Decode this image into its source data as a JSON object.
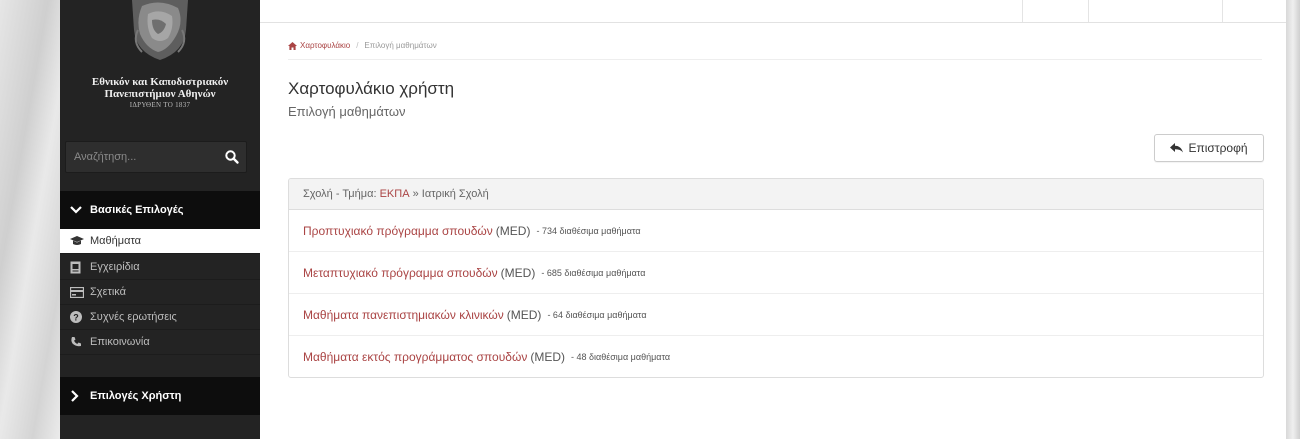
{
  "university": {
    "name_line1": "Εθνικόν και Καποδιστριακόν",
    "name_line2": "Πανεπιστήμιον Αθηνών",
    "founded": "ΙΔΡΥΘΕΝ ΤΟ 1837",
    "logo_icon": "athena-head-logo"
  },
  "search": {
    "placeholder": "Αναζήτηση...",
    "icon": "search-icon"
  },
  "sidebar": {
    "basic_header": "Βασικές Επιλογές",
    "user_header": "Επιλογές Χρήστη",
    "items": [
      {
        "label": "Μαθήματα",
        "icon": "graduation-cap-icon",
        "active": true
      },
      {
        "label": "Εγχειρίδια",
        "icon": "document-icon",
        "active": false
      },
      {
        "label": "Σχετικά",
        "icon": "card-icon",
        "active": false
      },
      {
        "label": "Συχνές ερωτήσεις",
        "icon": "question-circle-icon",
        "active": false
      },
      {
        "label": "Επικοινωνία",
        "icon": "phone-icon",
        "active": false
      }
    ]
  },
  "breadcrumb": {
    "home": "Χαρτοφυλάκιο",
    "current": "Επιλογή μαθημάτων",
    "separator": "/"
  },
  "page": {
    "title": "Χαρτοφυλάκιο χρήστη",
    "subtitle": "Επιλογή μαθημάτων",
    "back_label": "Επιστροφή"
  },
  "panel": {
    "prefix": "Σχολή - Τμήμα:",
    "institution": "ΕΚΠΑ",
    "arrow": "»",
    "school": "Ιατρική Σχολή",
    "rows": [
      {
        "program": "Προπτυχιακό πρόγραμμα σπουδών",
        "code": "(MED)",
        "count": "- 734 διαθέσιμα μαθήματα"
      },
      {
        "program": "Μεταπτυχιακό πρόγραμμα σπουδών",
        "code": "(MED)",
        "count": "- 685 διαθέσιμα μαθήματα"
      },
      {
        "program": "Μαθήματα πανεπιστημιακών κλινικών",
        "code": "(MED)",
        "count": "- 64 διαθέσιμα μαθήματα"
      },
      {
        "program": "Μαθήματα εκτός προγράμματος σπουδών",
        "code": "(MED)",
        "count": "- 48 διαθέσιμα μαθήματα"
      }
    ]
  },
  "colors": {
    "link": "#a44444",
    "sidebar_bg": "#232323",
    "header_bg": "#0d0d0d"
  }
}
